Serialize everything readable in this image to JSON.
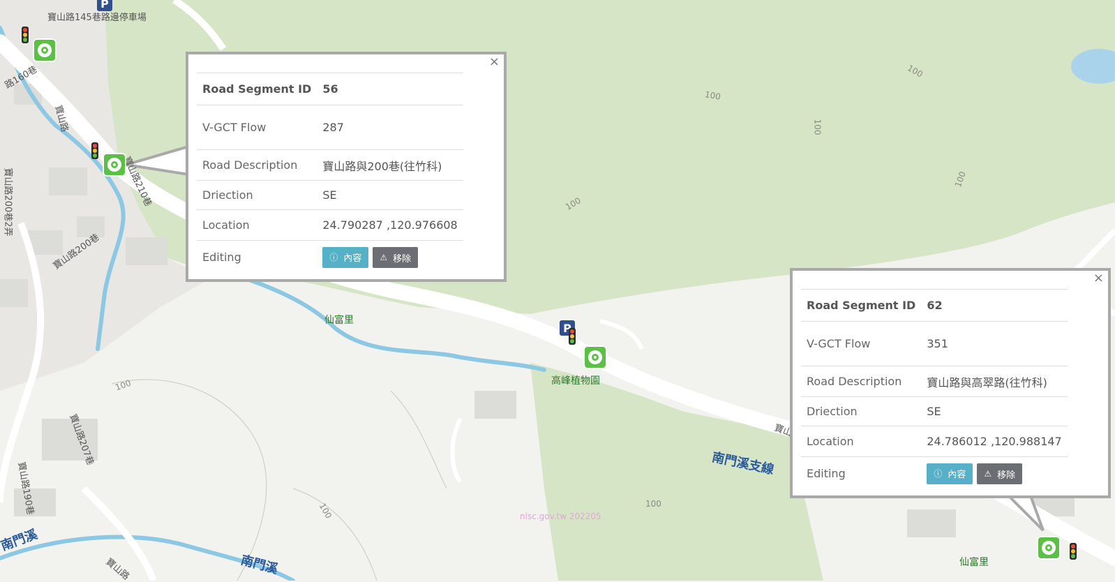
{
  "map": {
    "colors": {
      "background": "#f2f2ef",
      "forest": "#d6e5c6",
      "road": "#ffffff",
      "river": "#8cc7e3",
      "building": "#dcdcdc",
      "marker": "#5cbf46",
      "popup_border": "#a9a9a9",
      "flow_orange": "#e8a33a",
      "flow_red": "#d9413a"
    },
    "labels": {
      "parking_top": "寶山路145巷路邊停車場",
      "road_160": "路160巷",
      "road_baoshan_v": "寶山路",
      "road_200_2": "寶山路200巷2弄",
      "road_200": "寶山路200巷",
      "road_210": "寶山路210巷",
      "xianfu_1": "仙富里",
      "xianfu_2": "仙富里",
      "gaofeng": "高峰植物園",
      "nanmen_branch": "南門溪支線",
      "nanmen": "南門溪",
      "nanmen_2": "南門溪",
      "road_207": "寶山路207巷",
      "road_190": "寶山路190巷",
      "road_bottom": "寶山路",
      "road_right": "寶山",
      "watermark": "nlsc.gov.tw 202205",
      "contour": "100"
    },
    "parking_symbol": "P",
    "icons": {
      "marker": "vehicle-detector-marker-icon",
      "traffic_light": "traffic-light-icon",
      "parking": "parking-icon"
    }
  },
  "popups": [
    {
      "close": "×",
      "rows": {
        "segment_label": "Road Segment ID",
        "segment_value": "56",
        "flow_label": "V-GCT Flow",
        "flow_value": "287",
        "desc_label": "Road Description",
        "desc_value": "寶山路與200巷(往竹科)",
        "dir_label": "Driection",
        "dir_value": "SE",
        "loc_label": "Location",
        "loc_value": "24.790287 ,120.976608",
        "edit_label": "Editing"
      },
      "btn_info": "內容",
      "btn_remove": "移除"
    },
    {
      "close": "×",
      "rows": {
        "segment_label": "Road Segment ID",
        "segment_value": "62",
        "flow_label": "V-GCT Flow",
        "flow_value": "351",
        "desc_label": "Road Description",
        "desc_value": "寶山路與高翠路(往竹科)",
        "dir_label": "Driection",
        "dir_value": "SE",
        "loc_label": "Location",
        "loc_value": "24.786012 ,120.988147",
        "edit_label": "Editing"
      },
      "btn_info": "內容",
      "btn_remove": "移除"
    }
  ]
}
